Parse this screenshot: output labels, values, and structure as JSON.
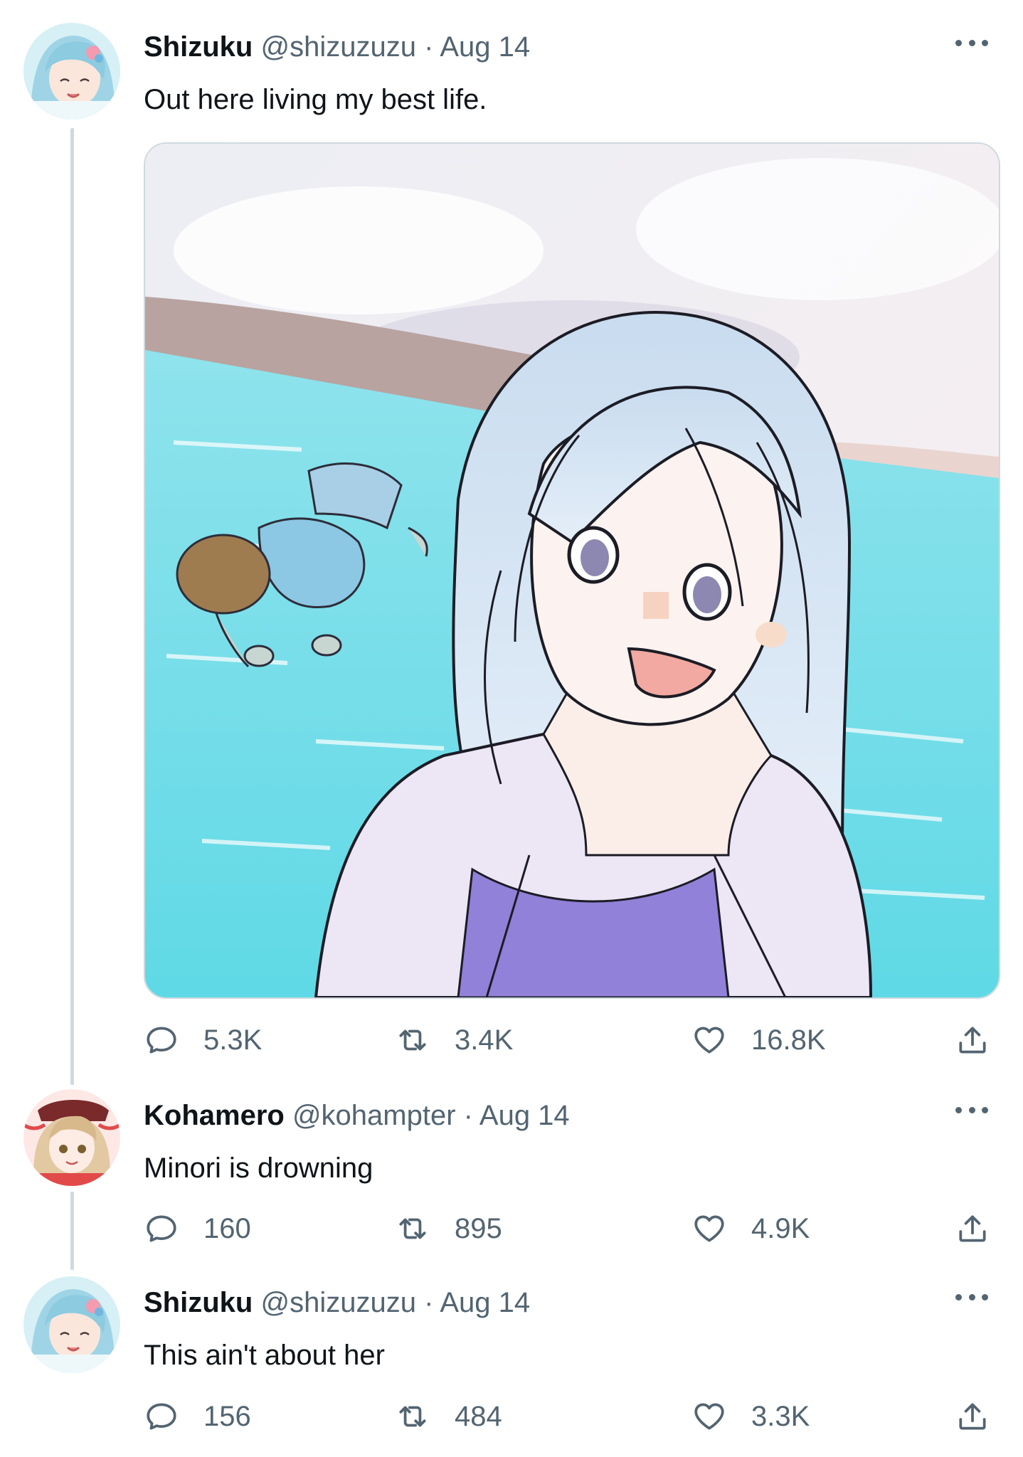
{
  "tweets": [
    {
      "author_name": "Shizuku",
      "handle": "@shizuzuzu",
      "separator": "·",
      "date": "Aug 14",
      "text": "Out here living my best life.",
      "replies": "5.3K",
      "retweets": "3.4K",
      "likes": "16.8K"
    },
    {
      "author_name": "Kohamero",
      "handle": "@kohampter",
      "separator": "·",
      "date": "Aug 14",
      "text": "Minori is drowning",
      "replies": "160",
      "retweets": "895",
      "likes": "4.9K"
    },
    {
      "author_name": "Shizuku",
      "handle": "@shizuzuzu",
      "separator": "·",
      "date": "Aug 14",
      "text": "This ain't about her",
      "replies": "156",
      "retweets": "484",
      "likes": "3.3K"
    }
  ],
  "icons": {
    "reply": "speech-bubble-icon",
    "retweet": "retweet-arrows-icon",
    "like": "heart-icon",
    "share": "share-upload-icon",
    "more": "more-dots-icon"
  },
  "colors": {
    "text_primary": "#0f1419",
    "text_secondary": "#536471",
    "thread_line": "#cfd9de",
    "media_border": "#cfd9de"
  }
}
